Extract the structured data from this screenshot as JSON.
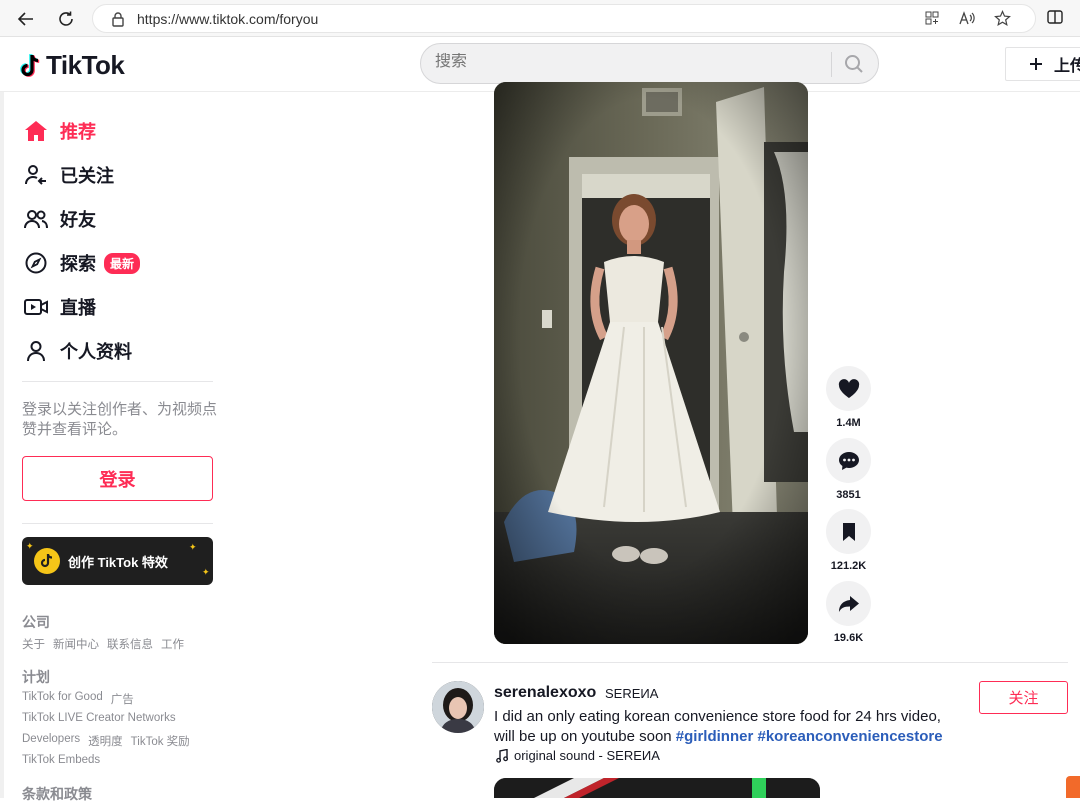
{
  "browser": {
    "url": "https://www.tiktok.com/foryou",
    "icons": [
      "back-icon",
      "refresh-icon",
      "lock-icon",
      "apps-icon",
      "read-aloud-icon",
      "favorite-star-icon",
      "split-screen-icon"
    ]
  },
  "header": {
    "logo_text": "TikTok",
    "search_placeholder": "搜索",
    "upload_label": "上传"
  },
  "sidebar": {
    "nav": [
      {
        "label": "推荐",
        "icon": "home-icon",
        "active": true
      },
      {
        "label": "已关注",
        "icon": "following-icon",
        "active": false
      },
      {
        "label": "好友",
        "icon": "friends-icon",
        "active": false
      },
      {
        "label": "探索",
        "icon": "explore-icon",
        "active": false,
        "badge": "最新"
      },
      {
        "label": "直播",
        "icon": "live-icon",
        "active": false
      },
      {
        "label": "个人资料",
        "icon": "profile-icon",
        "active": false
      }
    ],
    "login_hint": "登录以关注创作者、为视频点赞并查看评论。",
    "login_label": "登录",
    "effects_label": "创作 TikTok 特效",
    "footer": {
      "company_title": "公司",
      "company_links": [
        "关于",
        "新闻中心",
        "联系信息",
        "工作"
      ],
      "program_title": "计划",
      "program_row1": [
        "TikTok for Good",
        "广告"
      ],
      "program_row2": [
        "TikTok LIVE Creator Networks"
      ],
      "program_row3": [
        "Developers",
        "透明度",
        "TikTok 奖励"
      ],
      "program_row4": [
        "TikTok Embeds"
      ],
      "terms_title": "条款和政策"
    }
  },
  "video": {
    "actions": [
      {
        "icon": "heart-icon",
        "count": "1.4M"
      },
      {
        "icon": "comment-icon",
        "count": "3851"
      },
      {
        "icon": "bookmark-icon",
        "count": "121.2K"
      },
      {
        "icon": "share-icon",
        "count": "19.6K"
      }
    ]
  },
  "post": {
    "username": "serenalexoxo",
    "nickname": "SEREИA",
    "caption_text": "I did an only eating korean convenience store food for 24 hrs video, will be up on youtube soon ",
    "hashtags": [
      "#girldinner",
      "#koreanconveniencestore"
    ],
    "sound": "original sound - SEREИA",
    "follow_label": "关注"
  },
  "colors": {
    "brand": "#fe2c55",
    "hashtag": "#2b5db9",
    "muted": "#8a8b91"
  }
}
